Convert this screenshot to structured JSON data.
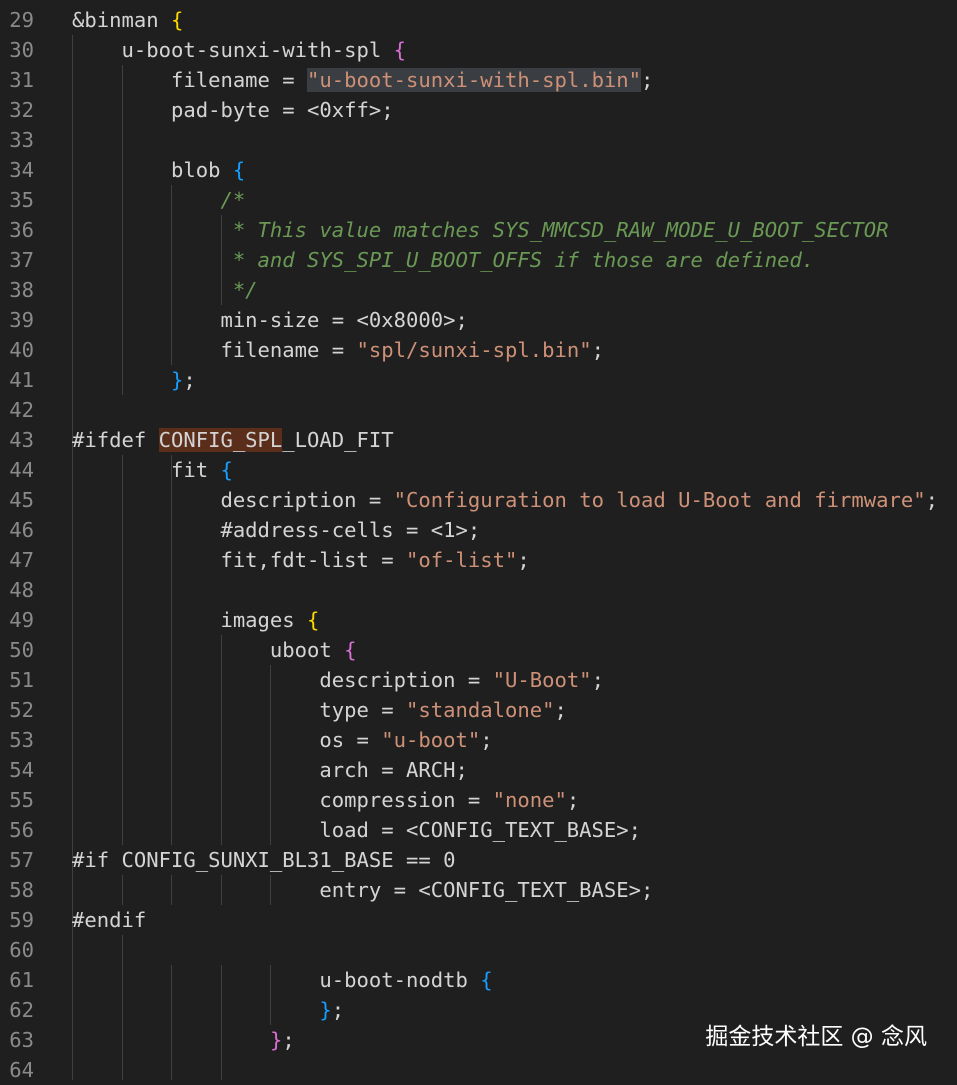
{
  "editor": {
    "lines": [
      {
        "n": "29",
        "segments": [
          {
            "t": "&binman ",
            "c": "default"
          },
          {
            "t": "{",
            "c": "brace-gold"
          }
        ]
      },
      {
        "n": "30",
        "segments": [
          {
            "t": "    u-boot-sunxi-with-spl ",
            "c": "default"
          },
          {
            "t": "{",
            "c": "brace-pink"
          }
        ]
      },
      {
        "n": "31",
        "segments": [
          {
            "t": "        filename = ",
            "c": "default"
          },
          {
            "t": "\"u-boot-sunxi-with-spl.bin\"",
            "c": "str",
            "hl": "sel"
          },
          {
            "t": ";",
            "c": "default"
          }
        ]
      },
      {
        "n": "32",
        "segments": [
          {
            "t": "        pad-byte = <0xff>;",
            "c": "default"
          }
        ]
      },
      {
        "n": "33",
        "segments": []
      },
      {
        "n": "34",
        "segments": [
          {
            "t": "        blob ",
            "c": "default"
          },
          {
            "t": "{",
            "c": "brace-blue"
          }
        ]
      },
      {
        "n": "35",
        "segments": [
          {
            "t": "            /*",
            "c": "comment"
          }
        ]
      },
      {
        "n": "36",
        "segments": [
          {
            "t": "             * This value matches SYS_MMCSD_RAW_MODE_U_BOOT_SECTOR",
            "c": "comment"
          }
        ]
      },
      {
        "n": "37",
        "segments": [
          {
            "t": "             * and SYS_SPI_U_BOOT_OFFS if those are defined.",
            "c": "comment"
          }
        ]
      },
      {
        "n": "38",
        "segments": [
          {
            "t": "             */",
            "c": "comment"
          }
        ]
      },
      {
        "n": "39",
        "segments": [
          {
            "t": "            min-size = <0x8000>;",
            "c": "default"
          }
        ]
      },
      {
        "n": "40",
        "segments": [
          {
            "t": "            filename = ",
            "c": "default"
          },
          {
            "t": "\"spl/sunxi-spl.bin\"",
            "c": "str"
          },
          {
            "t": ";",
            "c": "default"
          }
        ]
      },
      {
        "n": "41",
        "segments": [
          {
            "t": "        ",
            "c": "default"
          },
          {
            "t": "}",
            "c": "brace-blue"
          },
          {
            "t": ";",
            "c": "default"
          }
        ]
      },
      {
        "n": "42",
        "segments": []
      },
      {
        "n": "43",
        "segments": [
          {
            "t": "#ifdef ",
            "c": "default"
          },
          {
            "t": "CONFIG_SPL",
            "c": "default",
            "hl": "word"
          },
          {
            "t": "_LOAD_FIT",
            "c": "default"
          }
        ]
      },
      {
        "n": "44",
        "segments": [
          {
            "t": "        fit ",
            "c": "default"
          },
          {
            "t": "{",
            "c": "brace-blue"
          }
        ]
      },
      {
        "n": "45",
        "segments": [
          {
            "t": "            description = ",
            "c": "default"
          },
          {
            "t": "\"Configuration to load U-Boot and firmware\"",
            "c": "str"
          },
          {
            "t": ";",
            "c": "default"
          }
        ]
      },
      {
        "n": "46",
        "segments": [
          {
            "t": "            #address-cells = <1>;",
            "c": "default"
          }
        ]
      },
      {
        "n": "47",
        "segments": [
          {
            "t": "            fit,fdt-list = ",
            "c": "default"
          },
          {
            "t": "\"of-list\"",
            "c": "str"
          },
          {
            "t": ";",
            "c": "default"
          }
        ]
      },
      {
        "n": "48",
        "segments": []
      },
      {
        "n": "49",
        "segments": [
          {
            "t": "            images ",
            "c": "default"
          },
          {
            "t": "{",
            "c": "brace-gold"
          }
        ]
      },
      {
        "n": "50",
        "segments": [
          {
            "t": "                uboot ",
            "c": "default"
          },
          {
            "t": "{",
            "c": "brace-pink"
          }
        ]
      },
      {
        "n": "51",
        "segments": [
          {
            "t": "                    description = ",
            "c": "default"
          },
          {
            "t": "\"U-Boot\"",
            "c": "str"
          },
          {
            "t": ";",
            "c": "default"
          }
        ]
      },
      {
        "n": "52",
        "segments": [
          {
            "t": "                    type = ",
            "c": "default"
          },
          {
            "t": "\"standalone\"",
            "c": "str"
          },
          {
            "t": ";",
            "c": "default"
          }
        ]
      },
      {
        "n": "53",
        "segments": [
          {
            "t": "                    os = ",
            "c": "default"
          },
          {
            "t": "\"u-boot\"",
            "c": "str"
          },
          {
            "t": ";",
            "c": "default"
          }
        ]
      },
      {
        "n": "54",
        "segments": [
          {
            "t": "                    arch = ARCH;",
            "c": "default"
          }
        ]
      },
      {
        "n": "55",
        "segments": [
          {
            "t": "                    compression = ",
            "c": "default"
          },
          {
            "t": "\"none\"",
            "c": "str"
          },
          {
            "t": ";",
            "c": "default"
          }
        ]
      },
      {
        "n": "56",
        "segments": [
          {
            "t": "                    load = <CONFIG_TEXT_BASE>;",
            "c": "default"
          }
        ]
      },
      {
        "n": "57",
        "segments": [
          {
            "t": "#if CONFIG_SUNXI_BL31_BASE == 0",
            "c": "default"
          }
        ]
      },
      {
        "n": "58",
        "segments": [
          {
            "t": "                    entry = <CONFIG_TEXT_BASE>;",
            "c": "default"
          }
        ]
      },
      {
        "n": "59",
        "segments": [
          {
            "t": "#endif",
            "c": "default"
          }
        ]
      },
      {
        "n": "60",
        "segments": []
      },
      {
        "n": "61",
        "segments": [
          {
            "t": "                    u-boot-nodtb ",
            "c": "default"
          },
          {
            "t": "{",
            "c": "brace-blue"
          }
        ]
      },
      {
        "n": "62",
        "segments": [
          {
            "t": "                    ",
            "c": "default"
          },
          {
            "t": "}",
            "c": "brace-blue"
          },
          {
            "t": ";",
            "c": "default"
          }
        ]
      },
      {
        "n": "63",
        "segments": [
          {
            "t": "                ",
            "c": "default"
          },
          {
            "t": "}",
            "c": "brace-pink"
          },
          {
            "t": ";",
            "c": "default"
          }
        ]
      },
      {
        "n": "64",
        "segments": []
      }
    ]
  },
  "watermark": "掘金技术社区 @ 念风"
}
